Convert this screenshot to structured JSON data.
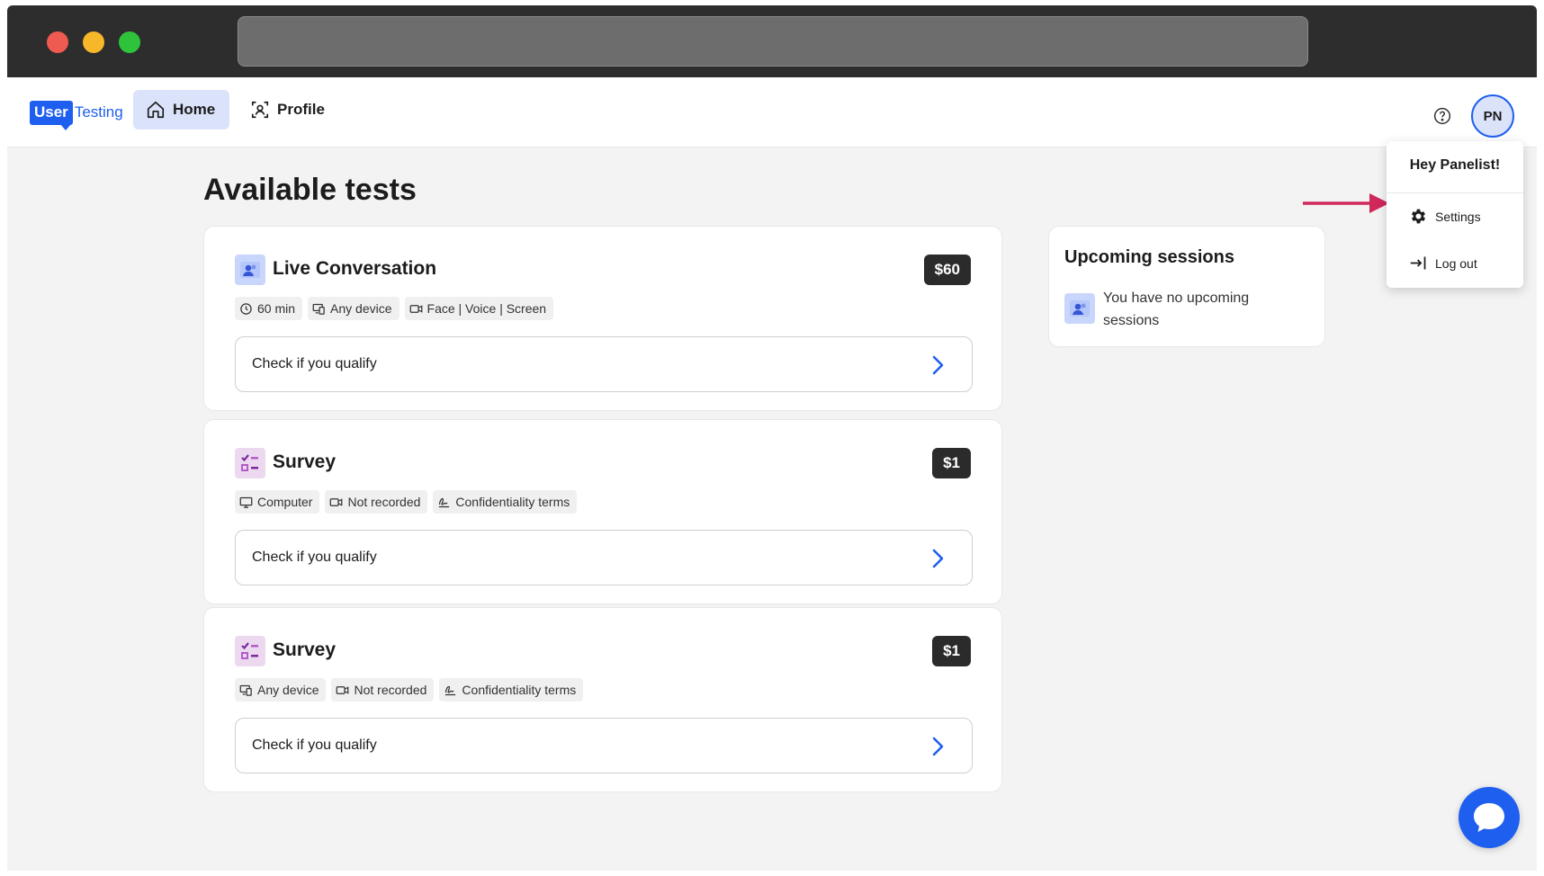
{
  "header": {
    "logo_user": "User",
    "logo_testing": "Testing",
    "nav": [
      {
        "label": "Home",
        "icon": "home-icon"
      },
      {
        "label": "Profile",
        "icon": "profile-icon"
      }
    ],
    "avatar_initials": "PN"
  },
  "main": {
    "title": "Available tests",
    "cards": [
      {
        "title": "Live Conversation",
        "icon": "live-conversation-icon",
        "price": "$60",
        "tags": [
          {
            "label": "60 min",
            "icon": "clock-icon"
          },
          {
            "label": "Any device",
            "icon": "devices-icon"
          },
          {
            "label": "Face | Voice | Screen",
            "icon": "camera-icon"
          }
        ],
        "action": "Check if you qualify"
      },
      {
        "title": "Survey",
        "icon": "survey-icon",
        "price": "$1",
        "tags": [
          {
            "label": "Computer",
            "icon": "computer-icon"
          },
          {
            "label": "Not recorded",
            "icon": "camera-icon"
          },
          {
            "label": "Confidentiality terms",
            "icon": "signature-icon"
          }
        ],
        "action": "Check if you qualify"
      },
      {
        "title": "Survey",
        "icon": "survey-icon",
        "price": "$1",
        "tags": [
          {
            "label": "Any device",
            "icon": "devices-icon"
          },
          {
            "label": "Not recorded",
            "icon": "camera-icon"
          },
          {
            "label": "Confidentiality terms",
            "icon": "signature-icon"
          }
        ],
        "action": "Check if you qualify"
      }
    ]
  },
  "sessions": {
    "title": "Upcoming sessions",
    "empty_text": "You have no upcoming sessions"
  },
  "menu": {
    "greeting": "Hey Panelist!",
    "items": [
      {
        "label": "Settings",
        "icon": "gear-icon"
      },
      {
        "label": "Log out",
        "icon": "logout-icon"
      }
    ]
  },
  "colors": {
    "brand": "#1f5fef",
    "nav_active_bg": "#dbe3fb",
    "price_bg": "#2b2b2b",
    "annotation_arrow": "#d0285a"
  }
}
